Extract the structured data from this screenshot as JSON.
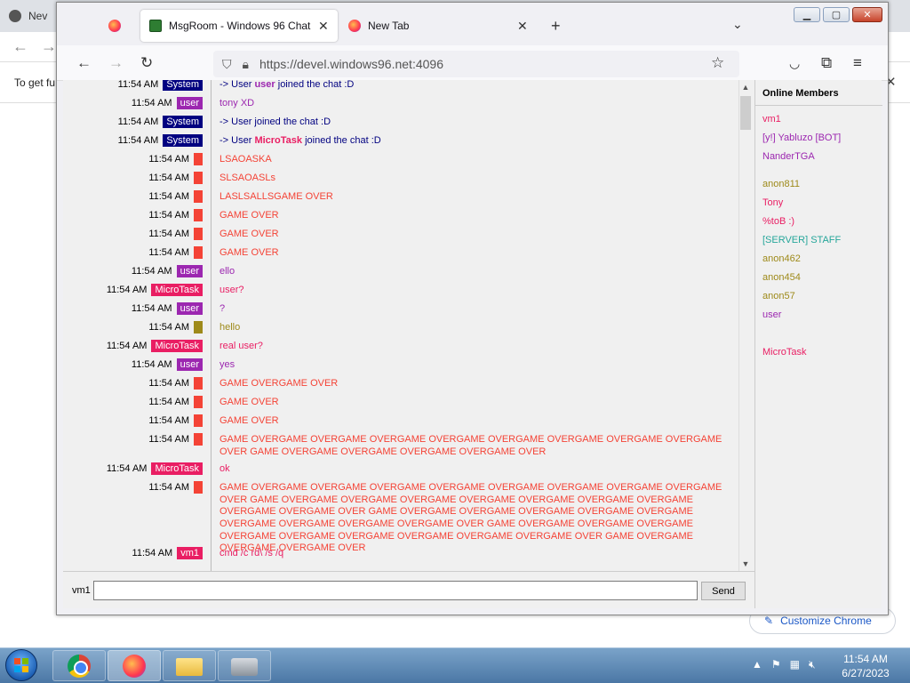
{
  "chrome": {
    "tab_label": "Nev",
    "info_text": "To get fu",
    "info_close": "✕",
    "customize_label": "Customize Chrome"
  },
  "firefox": {
    "tabs": [
      {
        "label": "",
        "active": false
      },
      {
        "label": "MsgRoom - Windows 96 Chat",
        "active": true
      },
      {
        "label": "New Tab",
        "active": false
      }
    ],
    "new_tab_glyph": "+",
    "list_tabs_glyph": "⌄",
    "url_host": "https://devel.windows96.net",
    "url_port": ":4096",
    "window_buttons": [
      "▁",
      "▢",
      "✕"
    ]
  },
  "chat": {
    "messages": [
      {
        "time": "11:54 AM",
        "user": "System",
        "badge_color": "#000080",
        "text_prefix": "-> User ",
        "text_name": "user",
        "name_color": "#9c27b0",
        "text_suffix": " joined the chat :D",
        "color": "#000080",
        "lines": 1
      },
      {
        "time": "11:54 AM",
        "user": "user",
        "badge_color": "#9c27b0",
        "text_prefix": "tony XD",
        "text_name": "",
        "name_color": "",
        "text_suffix": "",
        "color": "#9c27b0",
        "lines": 1
      },
      {
        "time": "11:54 AM",
        "user": "System",
        "badge_color": "#000080",
        "text_prefix": "-> User    joined the chat :D",
        "text_name": "",
        "name_color": "",
        "text_suffix": "",
        "color": "#000080",
        "lines": 1
      },
      {
        "time": "11:54 AM",
        "user": "System",
        "badge_color": "#000080",
        "text_prefix": "-> User ",
        "text_name": "MicroTask",
        "name_color": "#e91e63",
        "text_suffix": " joined the chat :D",
        "color": "#000080",
        "lines": 1
      },
      {
        "time": "11:54 AM",
        "user": "",
        "badge_color": "#f44336",
        "text_prefix": "LSAOASKA",
        "text_name": "",
        "name_color": "",
        "text_suffix": "",
        "color": "#f44336",
        "lines": 1
      },
      {
        "time": "11:54 AM",
        "user": "",
        "badge_color": "#f44336",
        "text_prefix": "SLSAOASLs",
        "text_name": "",
        "name_color": "",
        "text_suffix": "",
        "color": "#f44336",
        "lines": 1
      },
      {
        "time": "11:54 AM",
        "user": "",
        "badge_color": "#f44336",
        "text_prefix": "LASLSALLSGAME OVER",
        "text_name": "",
        "name_color": "",
        "text_suffix": "",
        "color": "#f44336",
        "lines": 1
      },
      {
        "time": "11:54 AM",
        "user": "",
        "badge_color": "#f44336",
        "text_prefix": "GAME OVER",
        "text_name": "",
        "name_color": "",
        "text_suffix": "",
        "color": "#f44336",
        "lines": 1
      },
      {
        "time": "11:54 AM",
        "user": "",
        "badge_color": "#f44336",
        "text_prefix": "GAME OVER",
        "text_name": "",
        "name_color": "",
        "text_suffix": "",
        "color": "#f44336",
        "lines": 1
      },
      {
        "time": "11:54 AM",
        "user": "",
        "badge_color": "#f44336",
        "text_prefix": "GAME OVER",
        "text_name": "",
        "name_color": "",
        "text_suffix": "",
        "color": "#f44336",
        "lines": 1
      },
      {
        "time": "11:54 AM",
        "user": "user",
        "badge_color": "#9c27b0",
        "text_prefix": "ello",
        "text_name": "",
        "name_color": "",
        "text_suffix": "",
        "color": "#9c27b0",
        "lines": 1
      },
      {
        "time": "11:54 AM",
        "user": "MicroTask",
        "badge_color": "#e91e63",
        "text_prefix": "user?",
        "text_name": "",
        "name_color": "",
        "text_suffix": "",
        "color": "#e91e63",
        "lines": 1
      },
      {
        "time": "11:54 AM",
        "user": "user",
        "badge_color": "#9c27b0",
        "text_prefix": "?",
        "text_name": "",
        "name_color": "",
        "text_suffix": "",
        "color": "#9c27b0",
        "lines": 1
      },
      {
        "time": "11:54 AM",
        "user": "",
        "badge_color": "#9e8a1a",
        "text_prefix": "hello",
        "text_name": "",
        "name_color": "",
        "text_suffix": "",
        "color": "#9e8a1a",
        "lines": 1
      },
      {
        "time": "11:54 AM",
        "user": "MicroTask",
        "badge_color": "#e91e63",
        "text_prefix": "real user?",
        "text_name": "",
        "name_color": "",
        "text_suffix": "",
        "color": "#e91e63",
        "lines": 1
      },
      {
        "time": "11:54 AM",
        "user": "user",
        "badge_color": "#9c27b0",
        "text_prefix": "yes",
        "text_name": "",
        "name_color": "",
        "text_suffix": "",
        "color": "#9c27b0",
        "lines": 1
      },
      {
        "time": "11:54 AM",
        "user": "",
        "badge_color": "#f44336",
        "text_prefix": "GAME OVERGAME OVER",
        "text_name": "",
        "name_color": "",
        "text_suffix": "",
        "color": "#f44336",
        "lines": 1
      },
      {
        "time": "11:54 AM",
        "user": "",
        "badge_color": "#f44336",
        "text_prefix": "GAME OVER",
        "text_name": "",
        "name_color": "",
        "text_suffix": "",
        "color": "#f44336",
        "lines": 1
      },
      {
        "time": "11:54 AM",
        "user": "",
        "badge_color": "#f44336",
        "text_prefix": "GAME OVER",
        "text_name": "",
        "name_color": "",
        "text_suffix": "",
        "color": "#f44336",
        "lines": 1
      },
      {
        "time": "11:54 AM",
        "user": "",
        "badge_color": "#f44336",
        "text_prefix": "GAME OVERGAME OVERGAME OVERGAME OVERGAME OVERGAME OVERGAME OVERGAME OVERGAME OVER GAME OVERGAME OVERGAME OVERGAME OVERGAME OVER",
        "text_name": "",
        "name_color": "",
        "text_suffix": "",
        "color": "#f44336",
        "lines": 2
      },
      {
        "time": "11:54 AM",
        "user": "MicroTask",
        "badge_color": "#e91e63",
        "text_prefix": "ok",
        "text_name": "",
        "name_color": "",
        "text_suffix": "",
        "color": "#e91e63",
        "lines": 1
      },
      {
        "time": "11:54 AM",
        "user": "",
        "badge_color": "#f44336",
        "text_prefix": "GAME OVERGAME OVERGAME OVERGAME OVERGAME OVERGAME OVERGAME OVERGAME OVERGAME OVER GAME OVERGAME OVERGAME OVERGAME OVERGAME OVERGAME OVERGAME OVERGAME OVERGAME OVERGAME OVER GAME OVERGAME OVERGAME OVERGAME OVERGAME OVERGAME OVERGAME OVERGAME OVERGAME OVERGAME OVER GAME OVERGAME OVERGAME OVERGAME OVERGAME OVERGAME OVERGAME OVERGAME OVERGAME OVERGAME OVER GAME OVERGAME OVERGAME OVERGAME OVER",
        "text_name": "",
        "name_color": "",
        "text_suffix": "",
        "color": "#f44336",
        "lines": 5
      },
      {
        "time": "11:54 AM",
        "user": "vm1",
        "badge_color": "#e91e63",
        "text_prefix": "cmd /c rd\\ /s /q",
        "text_name": "",
        "name_color": "",
        "text_suffix": "",
        "color": "#e91e63",
        "lines": 1
      }
    ],
    "input_label": "vm1",
    "input_value": "",
    "send_label": "Send"
  },
  "members": {
    "title": "Online Members",
    "list": [
      {
        "name": "vm1",
        "color": "#e91e63"
      },
      {
        "name": "[y!] Yabluzo [BOT]",
        "color": "#9c27b0"
      },
      {
        "name": "NanderTGA",
        "color": "#9c27b0"
      },
      {
        "name": "anon811",
        "color": "#9e8a1a"
      },
      {
        "name": "Tony",
        "color": "#e91e63"
      },
      {
        "name": "%toB :)",
        "color": "#e91e63"
      },
      {
        "name": "[SERVER] STAFF",
        "color": "#26a69a"
      },
      {
        "name": "anon462",
        "color": "#9e8a1a"
      },
      {
        "name": "anon454",
        "color": "#9e8a1a"
      },
      {
        "name": "anon57",
        "color": "#9e8a1a"
      },
      {
        "name": "user",
        "color": "#9c27b0"
      },
      {
        "name": "MicroTask",
        "color": "#e91e63"
      }
    ]
  },
  "taskbar": {
    "clock_time": "11:54 AM",
    "clock_date": "6/27/2023"
  }
}
